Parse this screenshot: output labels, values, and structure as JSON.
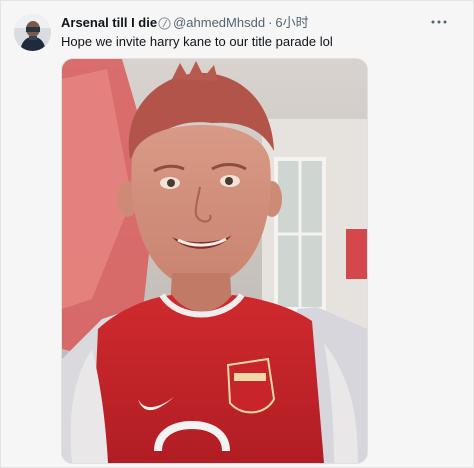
{
  "tweet": {
    "display_name": "Arsenal till I die",
    "handle": "@ahmedMhsdd",
    "separator": "·",
    "time": "6小时",
    "text": "Hope we invite harry kane to our title parade lol",
    "media_description_icon": "photo-of-child-in-red-arsenal-shirt"
  },
  "icons": {
    "verified": "verified-icon",
    "more": "more-icon"
  },
  "colors": {
    "background": "#f6f6f6",
    "text_primary": "#0f1419",
    "text_secondary": "#536471",
    "shirt_red": "#c8242b"
  }
}
